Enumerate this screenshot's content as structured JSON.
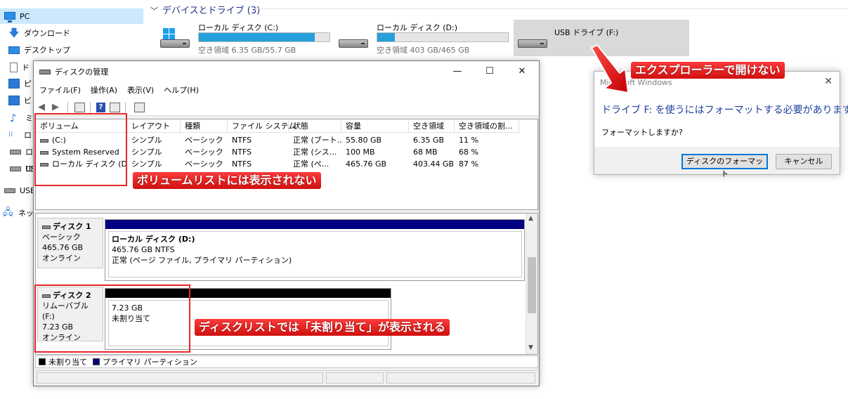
{
  "explorer": {
    "nav": [
      {
        "label": "PC",
        "icon": "pc-icon",
        "selected": true
      },
      {
        "label": "ダウンロード",
        "icon": "download-icon"
      },
      {
        "label": "デスクトップ",
        "icon": "desktop-icon"
      },
      {
        "label": "ド",
        "icon": "document-icon"
      },
      {
        "label": "ピ",
        "icon": "picture-icon"
      },
      {
        "label": "ビ",
        "icon": "video-icon"
      },
      {
        "label": "ミ",
        "icon": "music-icon"
      },
      {
        "label": "ロ",
        "icon": "objects-icon"
      },
      {
        "label": "ロ",
        "icon": "drive-icon"
      },
      {
        "label": "ロ",
        "icon": "drive-icon"
      },
      {
        "label": "US",
        "icon": "usb-drive-icon"
      },
      {
        "label": "USB",
        "icon": "usb-drive-icon"
      },
      {
        "label": "ネッ",
        "icon": "network-icon"
      }
    ],
    "group_title": "デバイスとドライブ (3)",
    "drives": [
      {
        "name": "ローカル ディスク (C:)",
        "free_text": "空き領域 6.35 GB/55.7 GB",
        "used_fraction": 0.886
      },
      {
        "name": "ローカル ディスク (D:)",
        "free_text": "空き領域 403 GB/465 GB",
        "used_fraction": 0.133
      },
      {
        "name": "USB ドライブ (F:)"
      }
    ]
  },
  "disk_mgmt": {
    "title": "ディスクの管理",
    "window_buttons": {
      "minimize": "—",
      "maximize": "☐",
      "close": "✕"
    },
    "menu": [
      "ファイル(F)",
      "操作(A)",
      "表示(V)",
      "ヘルプ(H)"
    ],
    "columns": [
      "ボリューム",
      "レイアウト",
      "種類",
      "ファイル システム",
      "状態",
      "容量",
      "空き領域",
      "空き領域の割..."
    ],
    "rows": [
      [
        "(C:)",
        "シンプル",
        "ベーシック",
        "NTFS",
        "正常 (ブート...",
        "55.80 GB",
        "6.35 GB",
        "11 %"
      ],
      [
        "System Reserved",
        "シンプル",
        "ベーシック",
        "NTFS",
        "正常 (シス...",
        "100 MB",
        "68 MB",
        "68 %"
      ],
      [
        "ローカル ディスク (D:)",
        "シンプル",
        "ベーシック",
        "NTFS",
        "正常 (ペ...",
        "465.76 GB",
        "403.44 GB",
        "87 %"
      ]
    ],
    "disks": [
      {
        "name": "ディスク 1",
        "type": "ベーシック",
        "size": "465.76 GB",
        "state": "オンライン",
        "partition": {
          "title": "ローカル ディスク (D:)",
          "line2": "465.76 GB NTFS",
          "line3": "正常 (ページ ファイル, プライマリ パーティション)",
          "stripe_color": "#000080"
        }
      },
      {
        "name": "ディスク 2",
        "type": "リムーバブル (F:)",
        "size": "7.23 GB",
        "state": "オンライン",
        "partition": {
          "line1": "7.23 GB",
          "line2": "未割り当て",
          "stripe_color": "#000000"
        }
      }
    ],
    "legend": [
      {
        "label": "未割り当て",
        "color": "#000000"
      },
      {
        "label": "プライマリ パーティション",
        "color": "#000080"
      }
    ]
  },
  "message_box": {
    "title": "Microsoft Windows",
    "close": "✕",
    "main": "ドライブ F: を使うにはフォーマットする必要があります。",
    "sub": "フォーマットしますか?",
    "buttons": {
      "format": "ディスクのフォーマット",
      "cancel": "キャンセル"
    }
  },
  "annotations": {
    "explorer": "エクスプローラーで開けない",
    "volume_list": "ボリュームリストには表示されない",
    "disk_list": "ディスクリストでは「未割り当て」が表示される",
    "accent": "#e8262a"
  }
}
